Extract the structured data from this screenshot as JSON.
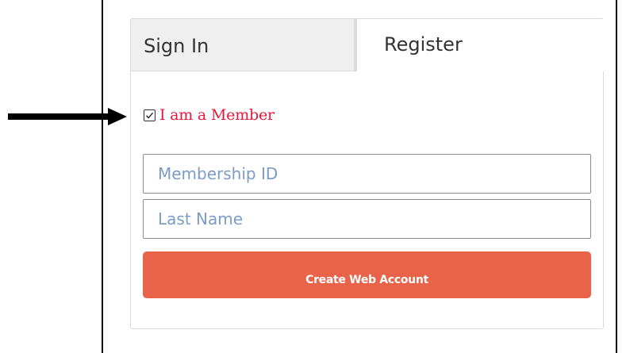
{
  "tabs": {
    "sign_in": "Sign In",
    "register": "Register",
    "active": "Register"
  },
  "member": {
    "label": "I am a Member",
    "checked": true,
    "color": "#e8173a"
  },
  "form": {
    "membership_id_placeholder": "Membership ID",
    "membership_id_value": "",
    "last_name_placeholder": "Last Name",
    "last_name_value": ""
  },
  "actions": {
    "create_label": "Create Web Account",
    "create_color": "#e8634a"
  },
  "annotation": {
    "arrow_icon": "arrow-right-icon"
  }
}
